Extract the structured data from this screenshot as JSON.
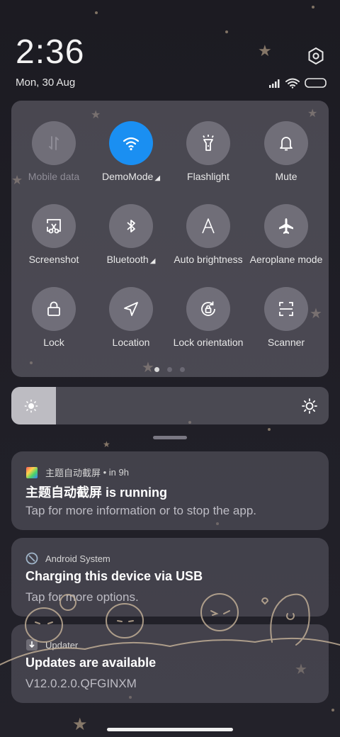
{
  "status": {
    "time": "2:36",
    "date": "Mon, 30 Aug",
    "icons": [
      "signal-icon",
      "wifi-icon",
      "battery-icon"
    ]
  },
  "quick_settings": {
    "tiles": [
      {
        "label": "Mobile data",
        "icon": "mobile-data-icon",
        "active": false,
        "enabled": false
      },
      {
        "label": "DemoMode",
        "icon": "wifi-icon",
        "active": true,
        "expandable": true
      },
      {
        "label": "Flashlight",
        "icon": "flashlight-icon",
        "active": false
      },
      {
        "label": "Mute",
        "icon": "bell-icon",
        "active": false
      },
      {
        "label": "Screenshot",
        "icon": "screenshot-icon",
        "active": false
      },
      {
        "label": "Bluetooth",
        "icon": "bluetooth-icon",
        "active": false,
        "expandable": true
      },
      {
        "label": "Auto brightness",
        "icon": "auto-brightness-icon",
        "active": false
      },
      {
        "label": "Aeroplane mode",
        "icon": "airplane-icon",
        "active": false
      },
      {
        "label": "Lock",
        "icon": "lock-icon",
        "active": false
      },
      {
        "label": "Location",
        "icon": "location-icon",
        "active": false
      },
      {
        "label": "Lock orientation",
        "icon": "lock-orientation-icon",
        "active": false
      },
      {
        "label": "Scanner",
        "icon": "scanner-icon",
        "active": false
      }
    ],
    "pages": 3,
    "current_page": 1
  },
  "brightness": {
    "level": 0.14
  },
  "notifications": [
    {
      "app": "主题自动截屏",
      "time": "in 9h",
      "title": "主题自动截屏 is running",
      "body": "Tap for more information or to stop the app."
    },
    {
      "app": "Android System",
      "title": "Charging this device via USB",
      "body": "Tap for more options."
    },
    {
      "app": "Updater",
      "title": "Updates are available",
      "body": "V12.0.2.0.QFGINXM"
    }
  ],
  "colors": {
    "accent": "#1a8ff2",
    "panel": "#5e5c66",
    "background": "#1e1d24"
  }
}
